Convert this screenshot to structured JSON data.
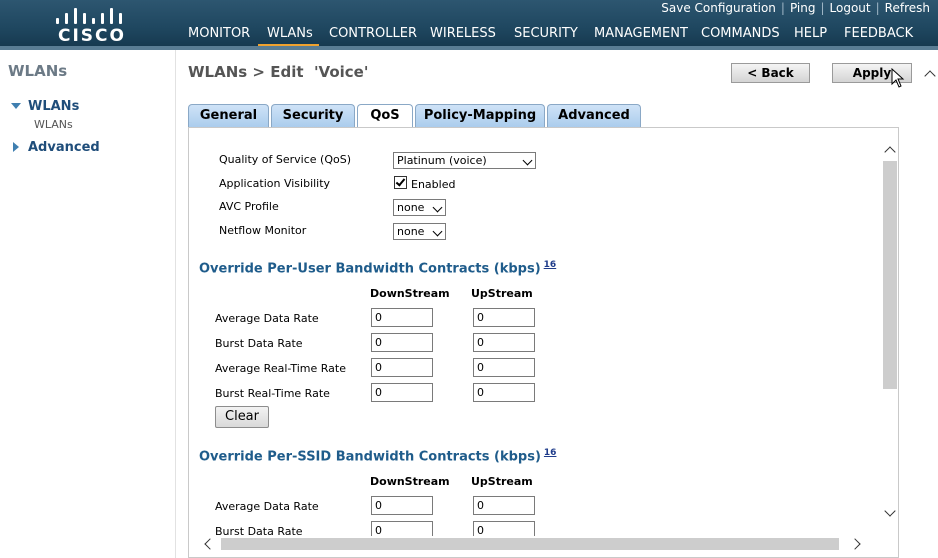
{
  "header": {
    "logo_text": "CISCO",
    "top_links": [
      "Save Configuration",
      "Ping",
      "Logout",
      "Refresh"
    ],
    "nav": [
      "MONITOR",
      "WLANs",
      "CONTROLLER",
      "WIRELESS",
      "SECURITY",
      "MANAGEMENT",
      "COMMANDS",
      "HELP",
      "FEEDBACK"
    ],
    "active_nav": "WLANs"
  },
  "sidebar": {
    "title": "WLANs",
    "items": [
      {
        "label": "WLANs",
        "expanded": true,
        "children": [
          "WLANs"
        ]
      },
      {
        "label": "Advanced",
        "expanded": false
      }
    ]
  },
  "main": {
    "title": "WLANs > Edit  'Voice'",
    "back_label": "< Back",
    "apply_label": "Apply",
    "tabs": [
      "General",
      "Security",
      "QoS",
      "Policy-Mapping",
      "Advanced"
    ],
    "active_tab": "QoS",
    "qos": {
      "qos_label": "Quality of Service (QoS)",
      "qos_value": "Platinum (voice)",
      "app_vis_label": "Application Visibility",
      "app_vis_checked": true,
      "app_vis_text": "Enabled",
      "avc_label": "AVC Profile",
      "avc_value": "none",
      "netflow_label": "Netflow Monitor",
      "netflow_value": "none"
    },
    "user_contracts": {
      "title": "Override Per-User Bandwidth Contracts (kbps)",
      "footnote": "16",
      "col_down": "DownStream",
      "col_up": "UpStream",
      "rows": [
        {
          "label": "Average Data Rate",
          "down": "0",
          "up": "0"
        },
        {
          "label": "Burst Data Rate",
          "down": "0",
          "up": "0"
        },
        {
          "label": "Average Real-Time Rate",
          "down": "0",
          "up": "0"
        },
        {
          "label": "Burst Real-Time Rate",
          "down": "0",
          "up": "0"
        }
      ],
      "clear_label": "Clear"
    },
    "ssid_contracts": {
      "title": "Override Per-SSID Bandwidth Contracts (kbps)",
      "footnote": "16",
      "col_down": "DownStream",
      "col_up": "UpStream",
      "rows": [
        {
          "label": "Average Data Rate",
          "down": "0",
          "up": "0"
        },
        {
          "label": "Burst Data Rate",
          "down": "0",
          "up": "0"
        }
      ]
    }
  },
  "colors": {
    "header_bg": "#1f4760",
    "nav_active_underline": "#f0a22e",
    "sidebar_link": "#1f4d7a",
    "section_title": "#1f5c8b",
    "tab_bg": "#a9cbec"
  }
}
